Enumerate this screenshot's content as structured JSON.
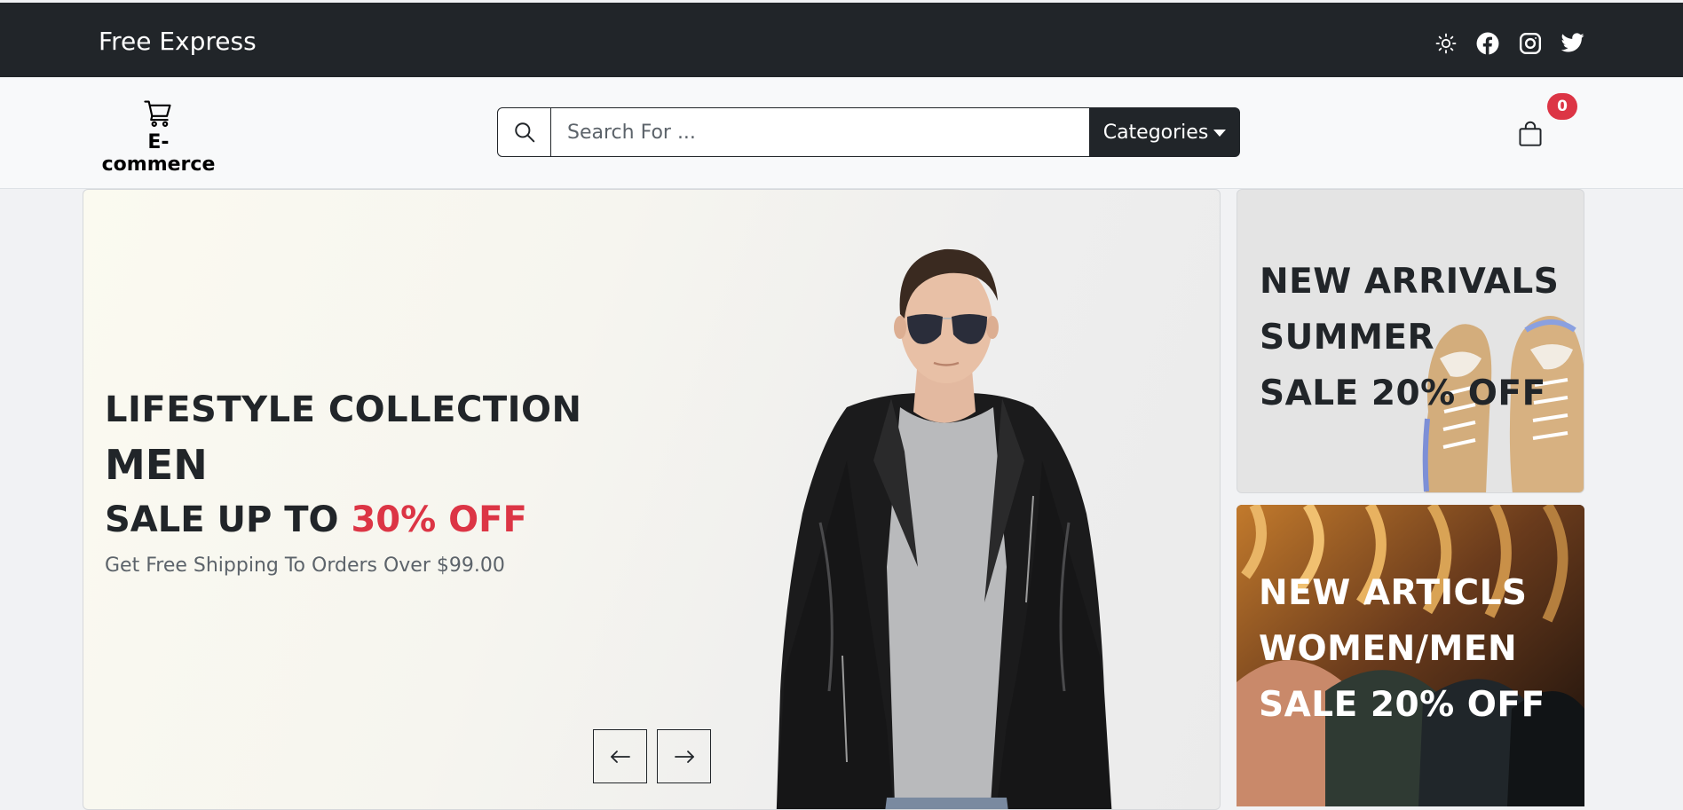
{
  "topbar": {
    "brand": "Free Express",
    "icons": [
      "sun-icon",
      "facebook-icon",
      "instagram-icon",
      "twitter-icon"
    ]
  },
  "header": {
    "logo_text": "E-commerce",
    "search_placeholder": "Search For ...",
    "categories_label": "Categories",
    "cart_count": "0"
  },
  "hero": {
    "line1": "LIFESTYLE COLLECTION",
    "line2": "MEN",
    "line3_prefix": "SALE UP TO ",
    "line3_accent": "30% OFF",
    "line4": "Get Free Shipping To Orders Over $99.00"
  },
  "promos": [
    {
      "line1": "NEW ARRIVALS",
      "line2": "SUMMER",
      "line3": "SALE 20% OFF"
    },
    {
      "line1": "NEW ARTICLS",
      "line2": "WOMEN/MEN",
      "line3": "SALE 20% OFF"
    }
  ],
  "colors": {
    "dark": "#212529",
    "accent": "#dc3545",
    "muted": "#5c636a"
  }
}
